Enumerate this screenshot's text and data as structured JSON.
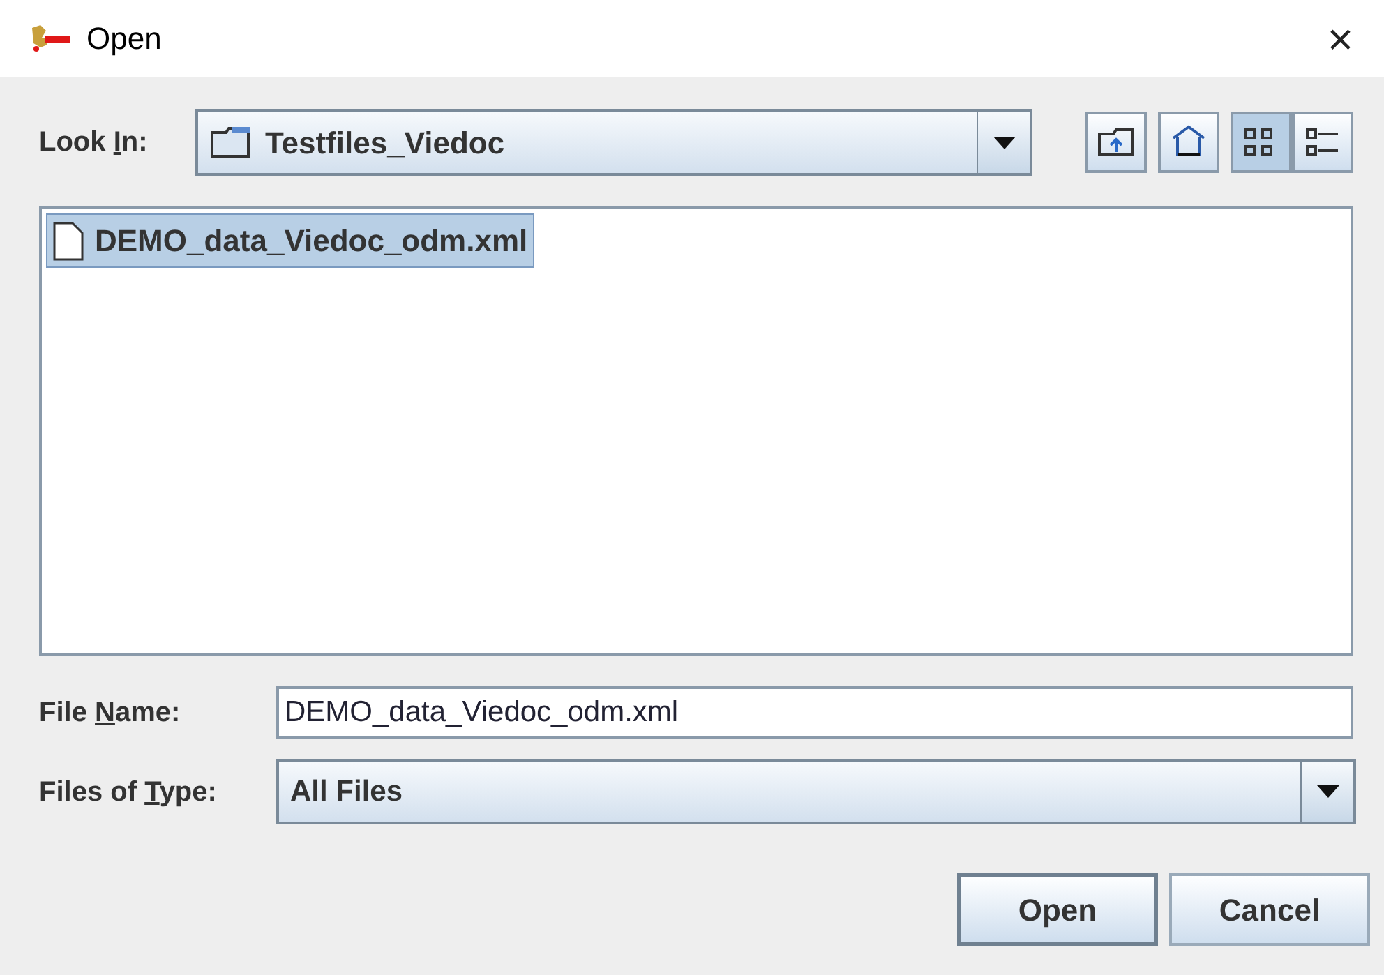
{
  "window": {
    "title": "Open",
    "close": "×"
  },
  "look_in": {
    "label": {
      "before": "Look ",
      "key": "I",
      "after": "n:"
    },
    "value": "Testfiles_Viedoc"
  },
  "toolbar": [
    {
      "kind": "up"
    },
    {
      "kind": "home"
    },
    {
      "kind": "list",
      "selected": true
    },
    {
      "kind": "details",
      "selected": false
    }
  ],
  "files": [
    {
      "name": "DEMO_data_Viedoc_odm.xml",
      "selected": true
    }
  ],
  "file_name": {
    "label": {
      "before": "File ",
      "key": "N",
      "after": "ame:"
    },
    "value": "DEMO_data_Viedoc_odm.xml"
  },
  "file_type": {
    "label": {
      "before": "Files of ",
      "key": "T",
      "after": "ype:"
    },
    "value": "All Files"
  },
  "buttons": [
    {
      "label": "Open",
      "default": true
    },
    {
      "label": "Cancel",
      "default": false
    }
  ]
}
